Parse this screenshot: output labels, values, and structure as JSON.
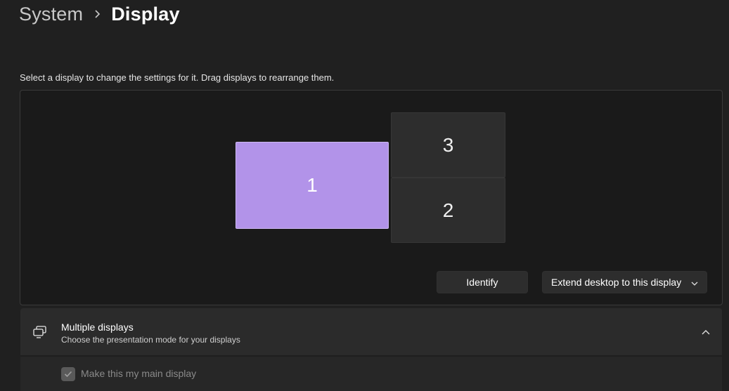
{
  "breadcrumb": {
    "parent": "System",
    "separator_icon": "chevron-right-icon",
    "current": "Display"
  },
  "instruction": "Select a display to change the settings for it. Drag displays to rearrange them.",
  "monitors": [
    {
      "number": "1",
      "selected": true,
      "color": "#b293e9"
    },
    {
      "number": "3",
      "selected": false,
      "color": "#2d2d2d"
    },
    {
      "number": "2",
      "selected": false,
      "color": "#2d2d2d"
    }
  ],
  "actions": {
    "identify_label": "Identify",
    "extend_select": {
      "value": "Extend desktop to this display",
      "icon": "chevron-down-icon"
    }
  },
  "multiple_displays": {
    "icon": "multiple-displays-icon",
    "title": "Multiple displays",
    "subtitle": "Choose the presentation mode for your displays",
    "expanded": true,
    "collapse_icon": "chevron-up-icon",
    "main_display_checkbox": {
      "label": "Make this my main display",
      "checked": true,
      "disabled": true
    }
  }
}
